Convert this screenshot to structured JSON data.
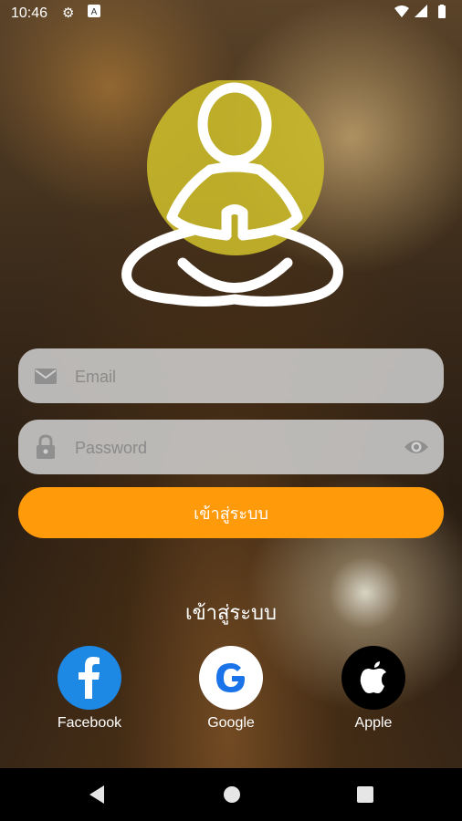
{
  "status_bar": {
    "time": "10:46"
  },
  "login_form": {
    "email_placeholder": "Email",
    "password_placeholder": "Password",
    "login_button": "เข้าสู่ระบบ"
  },
  "social_login": {
    "heading": "เข้าสู่ระบบ",
    "providers": [
      {
        "name": "Facebook",
        "icon": "facebook-icon",
        "color": "#1877f2"
      },
      {
        "name": "Google",
        "icon": "google-icon",
        "color": "#ffffff"
      },
      {
        "name": "Apple",
        "icon": "apple-icon",
        "color": "#000000"
      }
    ]
  },
  "colors": {
    "accent": "#ff9a0a",
    "logo_circle": "#c9b92a"
  }
}
